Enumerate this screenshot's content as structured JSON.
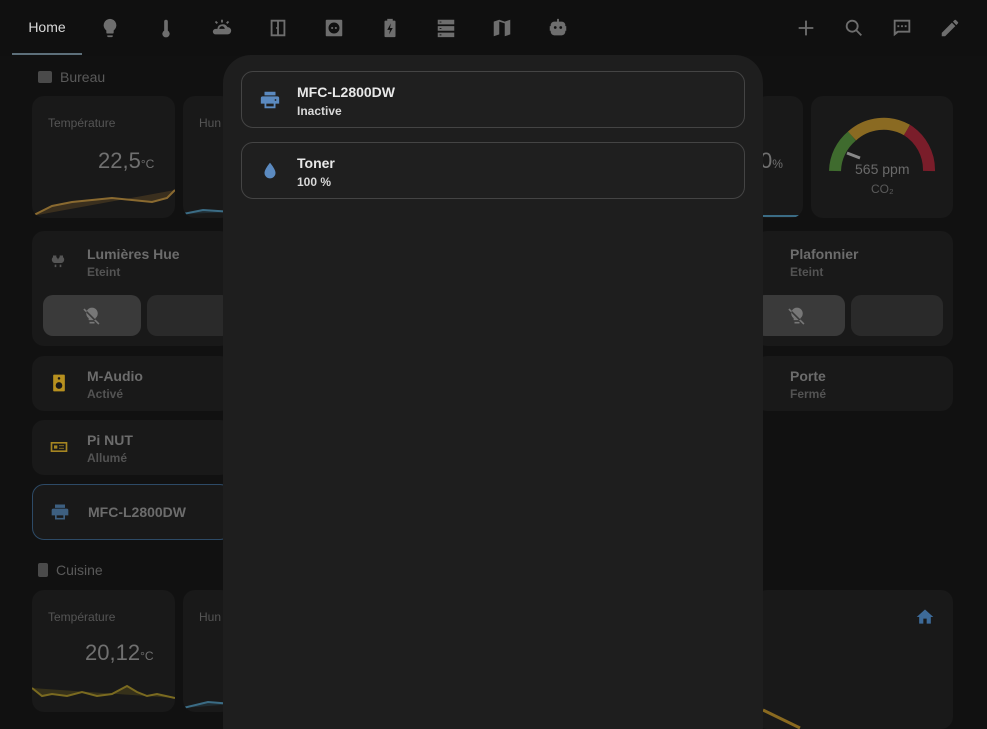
{
  "topbar": {
    "home_tab": "Home",
    "tabs": [
      "lightbulb-icon",
      "thermometer-icon",
      "weather-icon",
      "door-icon",
      "outlet-icon",
      "battery-icon",
      "server-icon",
      "map-icon",
      "robot-icon"
    ],
    "actions": [
      "plus-icon",
      "search-icon",
      "chat-icon",
      "pencil-icon"
    ]
  },
  "background": {
    "sections": [
      {
        "title": "Bureau"
      },
      {
        "title": "Cuisine"
      }
    ],
    "cards": {
      "temp1_label": "Température",
      "temp1_value": "22,5",
      "temp1_unit": "°C",
      "hum1_label": "Hun",
      "hum_right_value": "0",
      "hum_right_unit": "%",
      "co2_value": "565 ppm",
      "co2_label": "CO₂",
      "temp2_label": "Température",
      "temp2_value": "20,12",
      "temp2_unit": "°C",
      "hum2_label": "Hun"
    },
    "tiles": {
      "lights_name": "Lumières Hue",
      "lights_state": "Eteint",
      "ceiling_name": "Plafonnier",
      "ceiling_state": "Eteint",
      "audio_name": "M-Audio",
      "audio_state": "Activé",
      "door_name": "Porte",
      "door_state": "Fermé",
      "pi_name": "Pi NUT",
      "pi_state": "Allumé",
      "printer_name": "MFC-L2800DW"
    }
  },
  "dialog": {
    "entities": [
      {
        "icon": "printer-icon",
        "name": "MFC-L2800DW",
        "state": "Inactive"
      },
      {
        "icon": "water-drop-icon",
        "name": "Toner",
        "state": "100 %"
      }
    ]
  },
  "colors": {
    "accent_blue": "#5b8ac0",
    "audio_yellow": "#c9a227",
    "background": "#111111",
    "dialog": "#1e1e1e"
  }
}
